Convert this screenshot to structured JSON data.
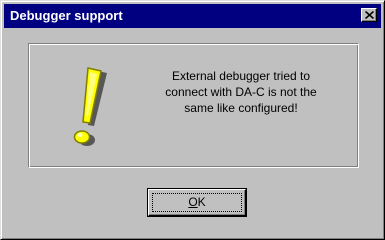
{
  "window": {
    "title": "Debugger support",
    "close_icon": "close-icon"
  },
  "message": {
    "icon": "exclamation-icon",
    "lines": [
      "External debugger tried to",
      "connect with DA-C is not the",
      "same like configured!"
    ]
  },
  "buttons": {
    "ok": {
      "accelerator": "O",
      "rest": "K"
    }
  },
  "colors": {
    "titlebar": "#000080",
    "title_text": "#ffffff",
    "face": "#c0c0c0",
    "exclamation_fill": "#ffff00",
    "exclamation_shadow": "#808000"
  }
}
